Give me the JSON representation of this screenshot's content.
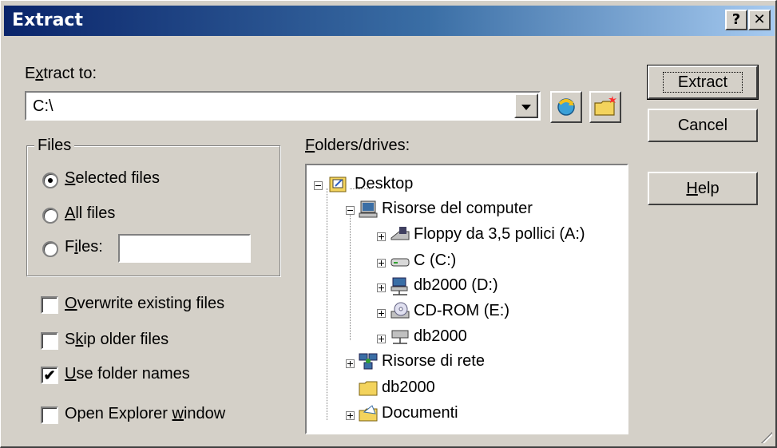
{
  "window": {
    "title": "Extract",
    "help_btn": "?",
    "close_btn": "✕"
  },
  "extract_to": {
    "label_pre": "E",
    "label_u": "x",
    "label_post": "tract to:",
    "value": "C:\\"
  },
  "buttons": {
    "extract": "Extract",
    "cancel": "Cancel",
    "help_u": "H",
    "help_post": "elp"
  },
  "files_group": {
    "label": "Files",
    "selected": {
      "u": "S",
      "post": "elected files",
      "checked": true
    },
    "all": {
      "u": "A",
      "post": "ll files",
      "checked": false
    },
    "files": {
      "pre": "F",
      "u": "i",
      "post": "les:",
      "checked": false,
      "value": ""
    }
  },
  "options": [
    {
      "u": "O",
      "pre": "",
      "post": "verwrite existing files",
      "checked": false
    },
    {
      "u": "k",
      "pre": "S",
      "post": "ip older files",
      "checked": false
    },
    {
      "u": "U",
      "pre": "",
      "post": "se folder names",
      "checked": true
    },
    {
      "u": "w",
      "pre": "Open Explorer ",
      "post": "indow",
      "checked": false
    }
  ],
  "tree": {
    "label_u": "F",
    "label_post": "olders/drives:",
    "nodes": [
      {
        "label": "Desktop",
        "icon": "desktop-icon"
      },
      {
        "label": "Risorse del computer",
        "icon": "my-computer-icon"
      },
      {
        "label": "Floppy da 3,5 pollici (A:)",
        "icon": "floppy-icon"
      },
      {
        "label": "C (C:)",
        "icon": "hard-drive-icon"
      },
      {
        "label": "db2000 (D:)",
        "icon": "network-drive-icon"
      },
      {
        "label": "CD-ROM (E:)",
        "icon": "cdrom-icon"
      },
      {
        "label": "db2000",
        "icon": "network-drive-icon"
      },
      {
        "label": "Risorse di rete",
        "icon": "network-places-icon"
      },
      {
        "label": "db2000",
        "icon": "folder-icon"
      },
      {
        "label": "Documenti",
        "icon": "documents-folder-icon"
      }
    ]
  }
}
